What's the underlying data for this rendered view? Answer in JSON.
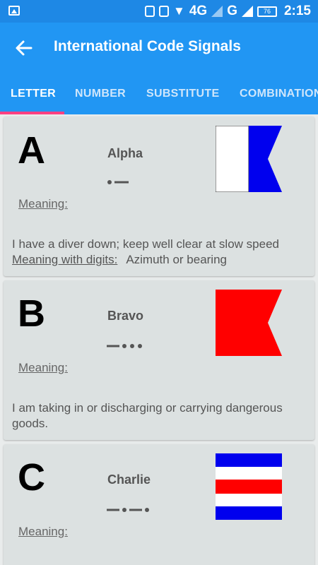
{
  "status_bar": {
    "time": "2:15",
    "network_1": "4G",
    "network_2": "G",
    "battery": "76",
    "icons": [
      "gallery-icon",
      "location-icon",
      "vibrate-icon",
      "wifi-icon",
      "signal-icon",
      "battery-icon"
    ]
  },
  "app_bar": {
    "title": "International Code Signals",
    "back_icon": "arrow-left-icon"
  },
  "tabs": [
    {
      "label": "LETTER",
      "active": true
    },
    {
      "label": "NUMBER",
      "active": false
    },
    {
      "label": "SUBSTITUTE",
      "active": false
    },
    {
      "label": "COMBINATION",
      "active": false
    }
  ],
  "colors": {
    "app_bar": "#2196f3",
    "status_bar": "#1e88e5",
    "tab_indicator": "#ff4081",
    "card": "#dce1e1"
  },
  "signals": [
    {
      "letter": "A",
      "word": "Alpha",
      "morse": ".-",
      "meaning_label": "Meaning:",
      "meaning": "I have a diver down; keep well clear at slow speed",
      "digits_label": "Meaning with digits:",
      "digits_meaning": "Azimuth or bearing",
      "flag": "alpha-flag"
    },
    {
      "letter": "B",
      "word": "Bravo",
      "morse": "-...",
      "meaning_label": "Meaning:",
      "meaning": "I am taking in or discharging or carrying dangerous goods.",
      "flag": "bravo-flag"
    },
    {
      "letter": "C",
      "word": "Charlie",
      "morse": "-.-.",
      "meaning_label": "Meaning:",
      "flag": "charlie-flag"
    }
  ]
}
